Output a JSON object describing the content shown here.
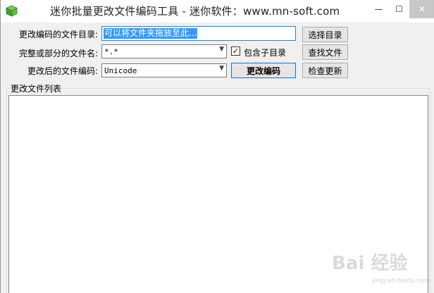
{
  "window": {
    "title": "迷你批量更改文件编码工具 - 迷你软件：www.mn-soft.com",
    "minimize_glyph": "—",
    "maximize_glyph": "☐",
    "close_glyph": "✕"
  },
  "form": {
    "dir_label": "更改编码的文件目录:",
    "dir_value": "可以将文件夹拖放至此...",
    "name_label": "完整或部分的文件名:",
    "name_value": "*.*",
    "include_sub_label": "包含子目录",
    "include_sub_checked": true,
    "encoding_label": "更改后的文件编码:",
    "encoding_value": "Unicode"
  },
  "buttons": {
    "choose_dir": "选择目录",
    "find_files": "查找文件",
    "change_encoding": "更改编码",
    "check_update": "检查更新"
  },
  "file_list": {
    "group_label": "更改文件列表"
  },
  "watermark": {
    "text": "Bai 经验",
    "url": "jingyan.baidu.com"
  },
  "icons": {
    "app": "green-cube-icon",
    "checkbox": "check-icon",
    "dropdown": "chevron-down-icon"
  }
}
